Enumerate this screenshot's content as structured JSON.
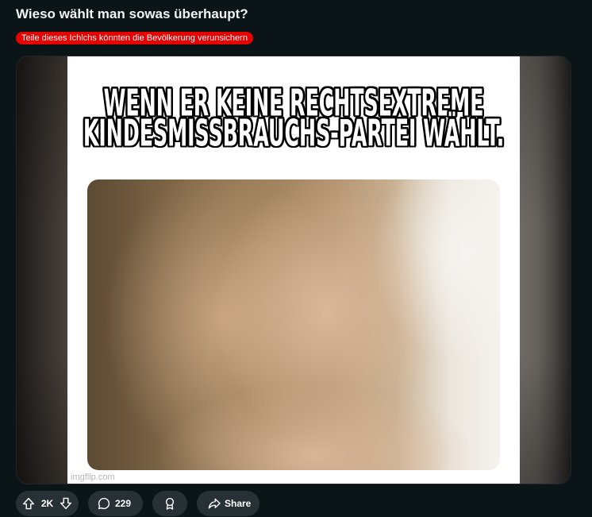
{
  "post": {
    "title": "Wieso wählt man sowas überhaupt?",
    "flair": {
      "text": "Teile dieses Ichlchs könnten die Bevölkerung verunsichern",
      "color": "#e60000"
    }
  },
  "media": {
    "caption_lines": [
      "WENN ER KEINE RECHTSEXTREME",
      "KINDESMISSBRAUCHS-PARTEI WÄHLT."
    ],
    "watermark": "imgflip.com"
  },
  "actions": {
    "vote": {
      "upvote_icon": "upvote-icon",
      "score": "2K",
      "downvote_icon": "downvote-icon"
    },
    "comments": {
      "icon": "comment-icon",
      "count": "229"
    },
    "award": {
      "icon": "award-icon"
    },
    "share": {
      "icon": "share-icon",
      "label": "Share"
    }
  },
  "theme": {
    "background": "#0b1416",
    "pill_background": "#263035",
    "text": "#f2f4f5"
  }
}
